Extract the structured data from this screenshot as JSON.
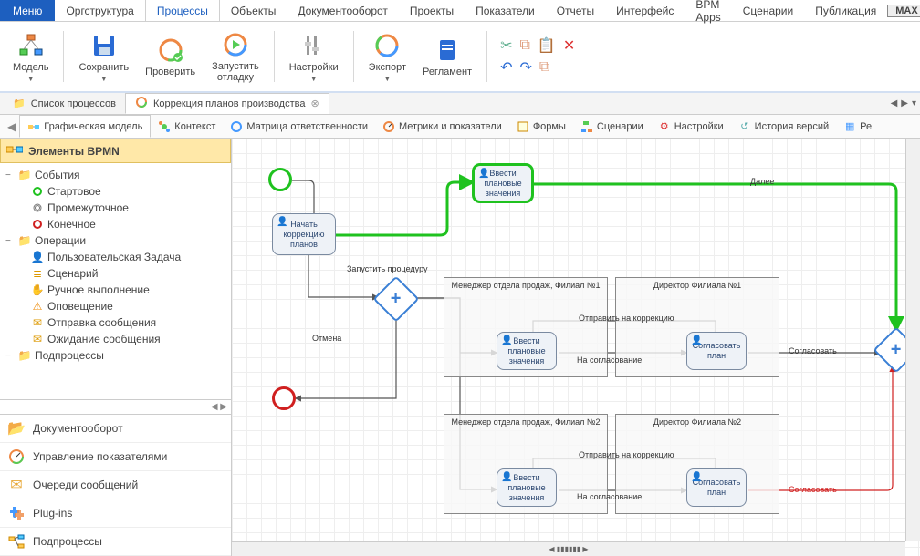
{
  "menu": {
    "button": "Меню",
    "tabs": [
      "Оргструктура",
      "Процессы",
      "Объекты",
      "Документооборот",
      "Проекты",
      "Показатели",
      "Отчеты",
      "Интерфейс",
      "BPM Apps",
      "Сценарии",
      "Публикация"
    ],
    "active": 1,
    "max": "MAX"
  },
  "ribbon": {
    "model": "Модель",
    "save": "Сохранить",
    "check": "Проверить",
    "debug_l1": "Запустить",
    "debug_l2": "отладку",
    "settings": "Настройки",
    "export": "Экспорт",
    "reglament": "Регламент"
  },
  "doc_tabs": {
    "list": "Список процессов",
    "active": "Коррекция планов производства"
  },
  "view_tabs": [
    "Графическая модель",
    "Контекст",
    "Матрица ответственности",
    "Метрики и показатели",
    "Формы",
    "Сценарии",
    "Настройки",
    "История версий",
    "Ре"
  ],
  "sidebar": {
    "header": "Элементы BPMN",
    "events_group": "События",
    "ev_start": "Стартовое",
    "ev_inter": "Промежуточное",
    "ev_end": "Конечное",
    "ops_group": "Операции",
    "op_user": "Пользовательская Задача",
    "op_scenario": "Сценарий",
    "op_manual": "Ручное выполнение",
    "op_notify": "Оповещение",
    "op_send": "Отправка сообщения",
    "op_wait": "Ожидание сообщения",
    "sub_group": "Подпроцессы",
    "cat_doc": "Документооборот",
    "cat_kpi": "Управление показателями",
    "cat_queue": "Очереди сообщений",
    "cat_plugins": "Plug-ins",
    "cat_sub": "Подпроцессы"
  },
  "diagram": {
    "task_start": "Начать коррекцию планов",
    "task_enter_top": "Ввести плановые значения",
    "task_enter1": "Ввести плановые значения",
    "task_approve1": "Согласовать план",
    "task_enter2": "Ввести плановые значения",
    "task_approve2": "Согласовать план",
    "pool_m1": "Менеджер отдела продаж, Филиал №1",
    "pool_d1": "Директор Филиала №1",
    "pool_m2": "Менеджер отдела продаж, Филиал №2",
    "pool_d2": "Директор Филиала №2",
    "lbl_next": "Далее",
    "lbl_run": "Запустить процедуру",
    "lbl_cancel": "Отмена",
    "lbl_corr1": "Отправить на коррекцию",
    "lbl_agree1": "На согласование",
    "lbl_ok1": "Согласовать",
    "lbl_corr2": "Отправить на коррекцию",
    "lbl_agree2": "На согласование",
    "lbl_ok2": "Согласовать"
  }
}
